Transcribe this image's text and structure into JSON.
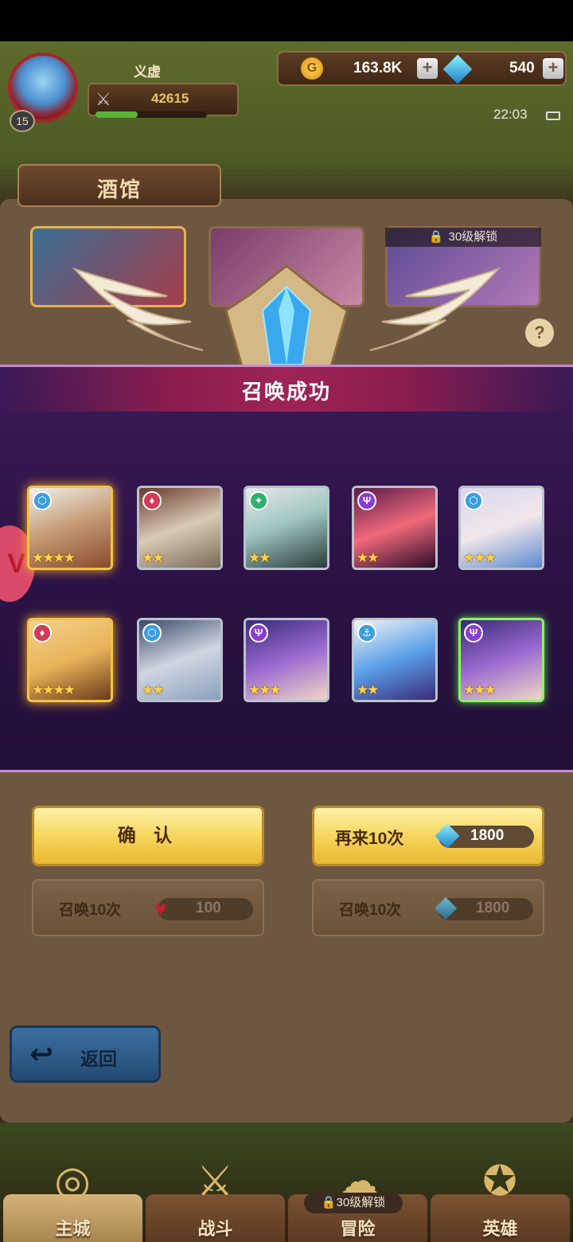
{
  "player": {
    "name": "义虚",
    "level": "15",
    "power": "42615"
  },
  "currency": {
    "gold": "163.8K",
    "gems": "540"
  },
  "clock": "22:03",
  "tavern": {
    "title": "酒馆",
    "lock_label": "30级解锁"
  },
  "banner": {
    "title": "召唤成功"
  },
  "heroes": [
    {
      "element": "water",
      "stars": "★★★★",
      "rarity": "gold"
    },
    {
      "element": "fire",
      "stars": "★★",
      "rarity": "normal"
    },
    {
      "element": "wind",
      "stars": "★★",
      "rarity": "normal"
    },
    {
      "element": "dark",
      "stars": "★★",
      "rarity": "normal"
    },
    {
      "element": "water",
      "stars": "★★★",
      "rarity": "normal"
    },
    {
      "element": "fire",
      "stars": "★★★★",
      "rarity": "gold"
    },
    {
      "element": "water",
      "stars": "★★",
      "rarity": "normal"
    },
    {
      "element": "dark",
      "stars": "★★★",
      "rarity": "normal"
    },
    {
      "element": "sea",
      "stars": "★★",
      "rarity": "normal"
    },
    {
      "element": "dark",
      "stars": "★★★",
      "rarity": "green"
    }
  ],
  "actions": {
    "confirm_label": "确 认",
    "again_label": "再来10次",
    "again_cost": "1800",
    "summon_left_label": "召唤10次",
    "summon_left_cost": "100",
    "summon_right_label": "召唤10次",
    "summon_right_cost": "1800"
  },
  "back_label": "返回",
  "nav": {
    "items": [
      "主城",
      "战斗",
      "冒险",
      "英雄"
    ],
    "adventure_lock": "30级解锁"
  },
  "icons": {
    "coin": "G",
    "plus": "+",
    "power": "⚔",
    "help": "?",
    "lock": "🔒",
    "back": "↩",
    "elem_water": "⬡",
    "elem_fire": "♦",
    "elem_wind": "✦",
    "elem_dark": "Ψ",
    "elem_sea": "⚓"
  },
  "colors": {
    "accent_gold": "#f6d65e",
    "banner_purple": "#2c1246"
  }
}
